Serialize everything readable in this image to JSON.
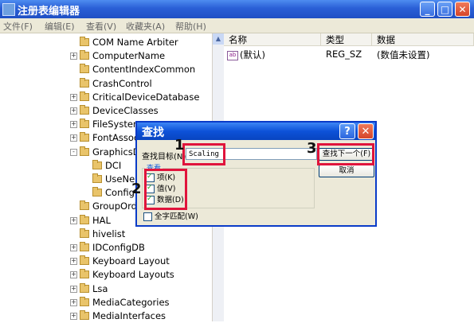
{
  "window": {
    "title": "注册表编辑器",
    "min_glyph": "_",
    "max_glyph": "□",
    "close_glyph": "✕"
  },
  "menu": [
    "文件(F)",
    "编辑(E)",
    "查看(V)",
    "收藏夹(A)",
    "帮助(H)"
  ],
  "tree": [
    {
      "label": "COM Name Arbiter",
      "indent": 0,
      "expander": ""
    },
    {
      "label": "ComputerName",
      "indent": 0,
      "expander": "+"
    },
    {
      "label": "ContentIndexCommon",
      "indent": 0,
      "expander": ""
    },
    {
      "label": "CrashControl",
      "indent": 0,
      "expander": ""
    },
    {
      "label": "CriticalDeviceDatabase",
      "indent": 0,
      "expander": "+"
    },
    {
      "label": "DeviceClasses",
      "indent": 0,
      "expander": "+"
    },
    {
      "label": "FileSystem",
      "indent": 0,
      "expander": "+"
    },
    {
      "label": "FontAssoc",
      "indent": 0,
      "expander": "+"
    },
    {
      "label": "GraphicsD",
      "indent": 0,
      "expander": "-"
    },
    {
      "label": "DCI",
      "indent": 1,
      "expander": ""
    },
    {
      "label": "UseNe",
      "indent": 1,
      "expander": ""
    },
    {
      "label": "Config",
      "indent": 1,
      "expander": ""
    },
    {
      "label": "GroupOrde",
      "indent": 0,
      "expander": ""
    },
    {
      "label": "HAL",
      "indent": 0,
      "expander": "+"
    },
    {
      "label": "hivelist",
      "indent": 0,
      "expander": ""
    },
    {
      "label": "IDConfigDB",
      "indent": 0,
      "expander": "+"
    },
    {
      "label": "Keyboard Layout",
      "indent": 0,
      "expander": "+"
    },
    {
      "label": "Keyboard Layouts",
      "indent": 0,
      "expander": "+"
    },
    {
      "label": "Lsa",
      "indent": 0,
      "expander": "+"
    },
    {
      "label": "MediaCategories",
      "indent": 0,
      "expander": "+"
    },
    {
      "label": "MediaInterfaces",
      "indent": 0,
      "expander": "+"
    }
  ],
  "list": {
    "headers": [
      "名称",
      "类型",
      "数据"
    ],
    "rows": [
      {
        "icon": "ab",
        "name": "(默认)",
        "type": "REG_SZ",
        "data": "(数值未设置)"
      }
    ]
  },
  "find_dialog": {
    "title": "查找",
    "help_glyph": "?",
    "close_glyph": "✕",
    "target_label": "查找目标(N):",
    "target_value": "Scaling",
    "find_next": "查找下一个(F)",
    "cancel": "取消",
    "group_label": "查看",
    "keys_label": "项(K)",
    "values_label": "值(V)",
    "data_label": "数据(D)",
    "whole_label": "全字匹配(W)",
    "keys_checked": true,
    "values_checked": true,
    "data_checked": true,
    "whole_checked": false
  },
  "callouts": [
    "1",
    "2",
    "3"
  ],
  "colors": {
    "callout": "#e0143c",
    "titlebar": "#2a5fd6"
  }
}
